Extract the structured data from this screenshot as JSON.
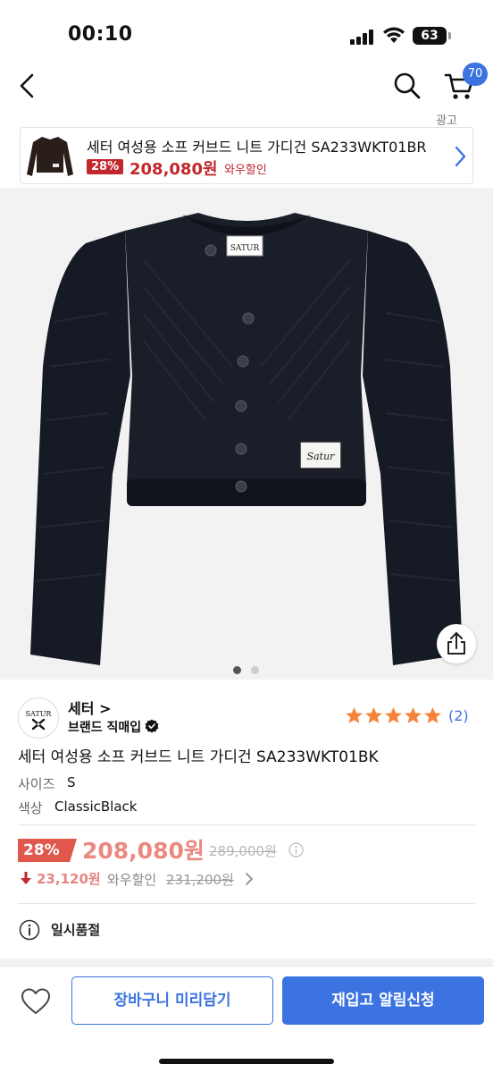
{
  "status_bar": {
    "time": "00:10",
    "battery": "63"
  },
  "nav": {
    "cart_count": "70",
    "ad_label": "광고"
  },
  "ad": {
    "title": "세터 여성용 소프 커브드 니트 가디건 SA233WKT01BR",
    "discount": "28%",
    "price": "208,080원",
    "wow": "와우할인"
  },
  "product_image": {
    "label_text": "SATUR",
    "patch_text": "Satur",
    "active_slide": 1,
    "total_slides": 2
  },
  "brand": {
    "logo_text": "SATUR",
    "name": "세터 >",
    "sub": "브랜드 직매입"
  },
  "rating": {
    "stars": 5,
    "count": "(2)"
  },
  "product": {
    "title": "세터 여성용 소프 커브드 니트 가디건 SA233WKT01BK",
    "options": [
      {
        "label": "사이즈",
        "value": "S"
      },
      {
        "label": "색상",
        "value": "ClassicBlack"
      }
    ]
  },
  "price": {
    "discount": "28%",
    "current": "208,080원",
    "original": "289,000원",
    "wow_amount": "23,120원",
    "wow_label": "와우할인",
    "wow_original": "231,200원"
  },
  "stock": {
    "status": "일시품절"
  },
  "bottom": {
    "cart_button": "장바구니 미리담기",
    "notify_button": "재입고 알림신청"
  },
  "colors": {
    "accent": "#3b73e0",
    "sale": "#c1272d",
    "price": "#e2574c",
    "star": "#f5843b"
  }
}
